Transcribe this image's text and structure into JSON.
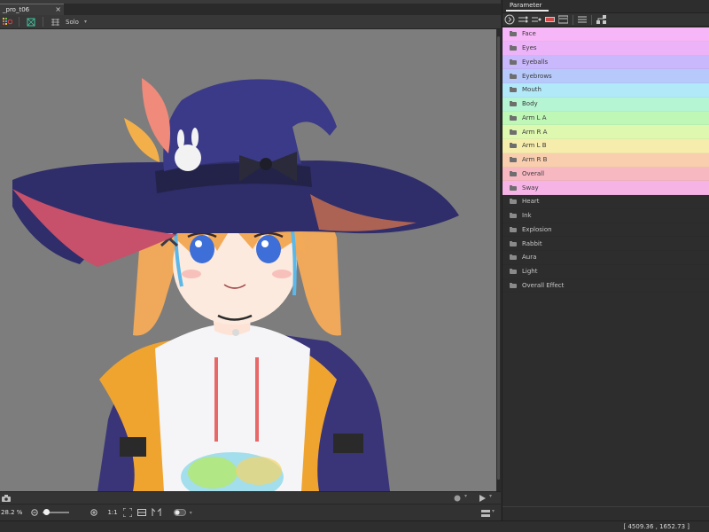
{
  "document": {
    "tab_title": "_pro_t06",
    "close_glyph": "×"
  },
  "toolbar": {
    "solo_label": "Solo",
    "dropdown_glyph": "⌄"
  },
  "viewport": {
    "background_color": "#7d7d7d"
  },
  "bottom_bar": {
    "zoom_text": "28.2 %",
    "one_to_one": "1:1",
    "zoom_level_fraction": 0.05
  },
  "status": {
    "coordinates": "[ 4509.36 , 1652.73 ]"
  },
  "parameter_panel": {
    "tab_label": "Parameter",
    "items": [
      {
        "label": "Face",
        "color": "#f7b6f7"
      },
      {
        "label": "Eyes",
        "color": "#ecb3f9"
      },
      {
        "label": "Eyeballs",
        "color": "#c9b8fb"
      },
      {
        "label": "Eyebrows",
        "color": "#b7c9fb"
      },
      {
        "label": "Mouth",
        "color": "#b2e9f9"
      },
      {
        "label": "Body",
        "color": "#b5f5d4"
      },
      {
        "label": "Arm L A",
        "color": "#bff7b7"
      },
      {
        "label": "Arm R A",
        "color": "#dff8b0"
      },
      {
        "label": "Arm L B",
        "color": "#f6edad"
      },
      {
        "label": "Arm R B",
        "color": "#f8ceaf"
      },
      {
        "label": "Overall",
        "color": "#f8b8c2"
      },
      {
        "label": "Sway",
        "color": "#f6b3e6"
      },
      {
        "label": "Heart",
        "color": ""
      },
      {
        "label": "Ink",
        "color": ""
      },
      {
        "label": "Explosion",
        "color": ""
      },
      {
        "label": "Rabbit",
        "color": ""
      },
      {
        "label": "Aura",
        "color": ""
      },
      {
        "label": "Light",
        "color": ""
      },
      {
        "label": "Overall Effect",
        "color": ""
      }
    ]
  }
}
